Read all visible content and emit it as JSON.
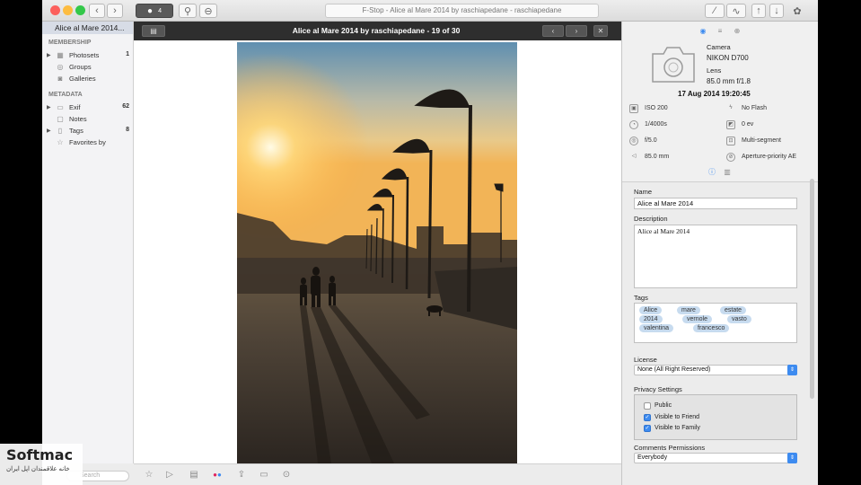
{
  "window": {
    "title": "F-Stop - Alice al Mare 2014 by raschiapedane - raschiapedane",
    "badge_count": "4"
  },
  "sidebar": {
    "selected_album": "Alice al Mare 2014...",
    "membership_header": "MEMBERSHIP",
    "metadata_header": "METADATA",
    "membership_items": [
      {
        "label": "Photosets",
        "count": "1"
      },
      {
        "label": "Groups",
        "count": ""
      },
      {
        "label": "Galleries",
        "count": ""
      }
    ],
    "metadata_items": [
      {
        "label": "Exif",
        "count": "62"
      },
      {
        "label": "Notes",
        "count": ""
      },
      {
        "label": "Tags",
        "count": "8"
      },
      {
        "label": "Favorites by",
        "count": ""
      }
    ],
    "search_placeholder": "Search"
  },
  "viewer": {
    "photo_title": "Alice al Mare 2014 by raschiapedane - 19 of 30"
  },
  "camera": {
    "camera_label": "Camera",
    "camera_model": "NIKON D700",
    "lens_label": "Lens",
    "lens_value": "85.0 mm f/1.8",
    "date": "17 Aug 2014 19:20:45"
  },
  "exif": [
    {
      "value": "ISO 200",
      "icon": "iso-icon"
    },
    {
      "value": "No Flash",
      "icon": "flash-icon"
    },
    {
      "value": "1/4000s",
      "icon": "shutter-icon"
    },
    {
      "value": "0 ev",
      "icon": "exposure-icon"
    },
    {
      "value": "f/5.0",
      "icon": "aperture-icon"
    },
    {
      "value": "Multi-segment",
      "icon": "metering-icon"
    },
    {
      "value": "85.0 mm",
      "icon": "focal-length-icon"
    },
    {
      "value": "Aperture-priority AE",
      "icon": "mode-icon"
    }
  ],
  "form": {
    "name_label": "Name",
    "name_value": "Alice al Mare 2014",
    "description_label": "Description",
    "description_value": "Alice al Mare 2014",
    "tags_label": "Tags",
    "tags": [
      "Alice",
      "mare",
      "estate",
      "2014",
      "vernole",
      "vasto",
      "valentina",
      "francesco"
    ],
    "license_label": "License",
    "license_value": "None (All Right Reserved)",
    "privacy_label": "Privacy Settings",
    "privacy_options": [
      {
        "label": "Public",
        "checked": false
      },
      {
        "label": "Visible to Friend",
        "checked": true
      },
      {
        "label": "Visible to Family",
        "checked": true
      }
    ],
    "comments_label": "Comments Permissions",
    "comments_value": "Everybody"
  },
  "watermark": {
    "brand": "Softmac",
    "tagline": "خانه علاقمندان اپل ایران"
  },
  "colors": {
    "accent": "#3d8bf0",
    "tag_bg": "#c7dbef",
    "header_dark": "#2e2e2e"
  }
}
